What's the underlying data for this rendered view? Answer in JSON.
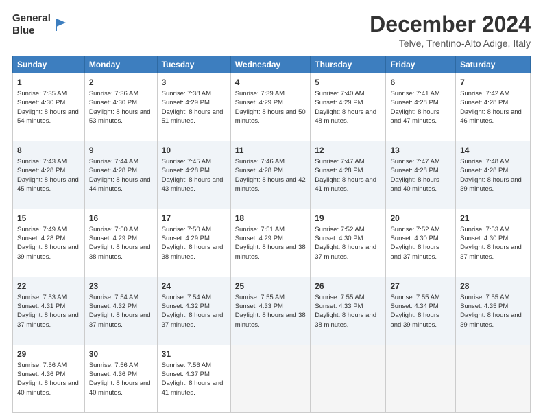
{
  "logo": {
    "line1": "General",
    "line2": "Blue"
  },
  "title": "December 2024",
  "subtitle": "Telve, Trentino-Alto Adige, Italy",
  "days_of_week": [
    "Sunday",
    "Monday",
    "Tuesday",
    "Wednesday",
    "Thursday",
    "Friday",
    "Saturday"
  ],
  "weeks": [
    [
      {
        "day": "1",
        "sunrise": "Sunrise: 7:35 AM",
        "sunset": "Sunset: 4:30 PM",
        "daylight": "Daylight: 8 hours and 54 minutes."
      },
      {
        "day": "2",
        "sunrise": "Sunrise: 7:36 AM",
        "sunset": "Sunset: 4:30 PM",
        "daylight": "Daylight: 8 hours and 53 minutes."
      },
      {
        "day": "3",
        "sunrise": "Sunrise: 7:38 AM",
        "sunset": "Sunset: 4:29 PM",
        "daylight": "Daylight: 8 hours and 51 minutes."
      },
      {
        "day": "4",
        "sunrise": "Sunrise: 7:39 AM",
        "sunset": "Sunset: 4:29 PM",
        "daylight": "Daylight: 8 hours and 50 minutes."
      },
      {
        "day": "5",
        "sunrise": "Sunrise: 7:40 AM",
        "sunset": "Sunset: 4:29 PM",
        "daylight": "Daylight: 8 hours and 48 minutes."
      },
      {
        "day": "6",
        "sunrise": "Sunrise: 7:41 AM",
        "sunset": "Sunset: 4:28 PM",
        "daylight": "Daylight: 8 hours and 47 minutes."
      },
      {
        "day": "7",
        "sunrise": "Sunrise: 7:42 AM",
        "sunset": "Sunset: 4:28 PM",
        "daylight": "Daylight: 8 hours and 46 minutes."
      }
    ],
    [
      {
        "day": "8",
        "sunrise": "Sunrise: 7:43 AM",
        "sunset": "Sunset: 4:28 PM",
        "daylight": "Daylight: 8 hours and 45 minutes."
      },
      {
        "day": "9",
        "sunrise": "Sunrise: 7:44 AM",
        "sunset": "Sunset: 4:28 PM",
        "daylight": "Daylight: 8 hours and 44 minutes."
      },
      {
        "day": "10",
        "sunrise": "Sunrise: 7:45 AM",
        "sunset": "Sunset: 4:28 PM",
        "daylight": "Daylight: 8 hours and 43 minutes."
      },
      {
        "day": "11",
        "sunrise": "Sunrise: 7:46 AM",
        "sunset": "Sunset: 4:28 PM",
        "daylight": "Daylight: 8 hours and 42 minutes."
      },
      {
        "day": "12",
        "sunrise": "Sunrise: 7:47 AM",
        "sunset": "Sunset: 4:28 PM",
        "daylight": "Daylight: 8 hours and 41 minutes."
      },
      {
        "day": "13",
        "sunrise": "Sunrise: 7:47 AM",
        "sunset": "Sunset: 4:28 PM",
        "daylight": "Daylight: 8 hours and 40 minutes."
      },
      {
        "day": "14",
        "sunrise": "Sunrise: 7:48 AM",
        "sunset": "Sunset: 4:28 PM",
        "daylight": "Daylight: 8 hours and 39 minutes."
      }
    ],
    [
      {
        "day": "15",
        "sunrise": "Sunrise: 7:49 AM",
        "sunset": "Sunset: 4:28 PM",
        "daylight": "Daylight: 8 hours and 39 minutes."
      },
      {
        "day": "16",
        "sunrise": "Sunrise: 7:50 AM",
        "sunset": "Sunset: 4:29 PM",
        "daylight": "Daylight: 8 hours and 38 minutes."
      },
      {
        "day": "17",
        "sunrise": "Sunrise: 7:50 AM",
        "sunset": "Sunset: 4:29 PM",
        "daylight": "Daylight: 8 hours and 38 minutes."
      },
      {
        "day": "18",
        "sunrise": "Sunrise: 7:51 AM",
        "sunset": "Sunset: 4:29 PM",
        "daylight": "Daylight: 8 hours and 38 minutes."
      },
      {
        "day": "19",
        "sunrise": "Sunrise: 7:52 AM",
        "sunset": "Sunset: 4:30 PM",
        "daylight": "Daylight: 8 hours and 37 minutes."
      },
      {
        "day": "20",
        "sunrise": "Sunrise: 7:52 AM",
        "sunset": "Sunset: 4:30 PM",
        "daylight": "Daylight: 8 hours and 37 minutes."
      },
      {
        "day": "21",
        "sunrise": "Sunrise: 7:53 AM",
        "sunset": "Sunset: 4:30 PM",
        "daylight": "Daylight: 8 hours and 37 minutes."
      }
    ],
    [
      {
        "day": "22",
        "sunrise": "Sunrise: 7:53 AM",
        "sunset": "Sunset: 4:31 PM",
        "daylight": "Daylight: 8 hours and 37 minutes."
      },
      {
        "day": "23",
        "sunrise": "Sunrise: 7:54 AM",
        "sunset": "Sunset: 4:32 PM",
        "daylight": "Daylight: 8 hours and 37 minutes."
      },
      {
        "day": "24",
        "sunrise": "Sunrise: 7:54 AM",
        "sunset": "Sunset: 4:32 PM",
        "daylight": "Daylight: 8 hours and 37 minutes."
      },
      {
        "day": "25",
        "sunrise": "Sunrise: 7:55 AM",
        "sunset": "Sunset: 4:33 PM",
        "daylight": "Daylight: 8 hours and 38 minutes."
      },
      {
        "day": "26",
        "sunrise": "Sunrise: 7:55 AM",
        "sunset": "Sunset: 4:33 PM",
        "daylight": "Daylight: 8 hours and 38 minutes."
      },
      {
        "day": "27",
        "sunrise": "Sunrise: 7:55 AM",
        "sunset": "Sunset: 4:34 PM",
        "daylight": "Daylight: 8 hours and 39 minutes."
      },
      {
        "day": "28",
        "sunrise": "Sunrise: 7:55 AM",
        "sunset": "Sunset: 4:35 PM",
        "daylight": "Daylight: 8 hours and 39 minutes."
      }
    ],
    [
      {
        "day": "29",
        "sunrise": "Sunrise: 7:56 AM",
        "sunset": "Sunset: 4:36 PM",
        "daylight": "Daylight: 8 hours and 40 minutes."
      },
      {
        "day": "30",
        "sunrise": "Sunrise: 7:56 AM",
        "sunset": "Sunset: 4:36 PM",
        "daylight": "Daylight: 8 hours and 40 minutes."
      },
      {
        "day": "31",
        "sunrise": "Sunrise: 7:56 AM",
        "sunset": "Sunset: 4:37 PM",
        "daylight": "Daylight: 8 hours and 41 minutes."
      },
      null,
      null,
      null,
      null
    ]
  ]
}
